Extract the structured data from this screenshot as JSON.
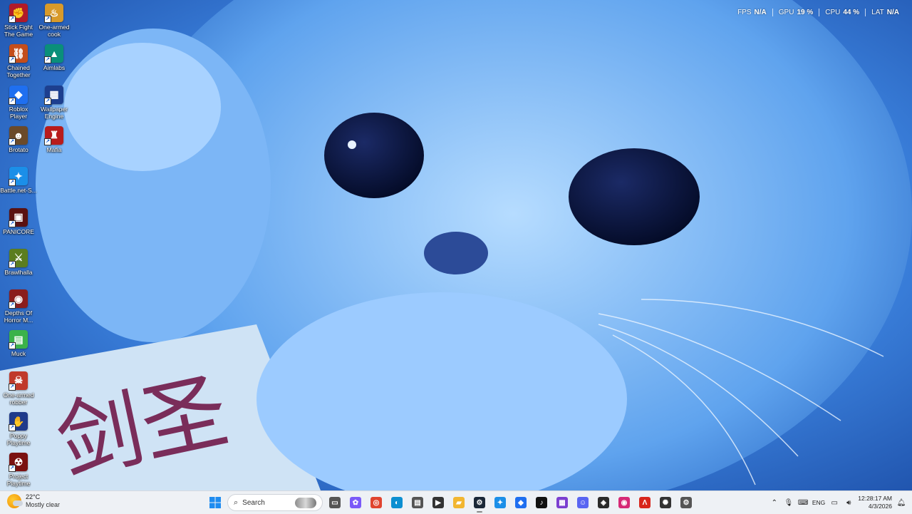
{
  "desktop": {
    "icons_col1": [
      {
        "label": "Stick Fight The Game",
        "glyph": "✊",
        "color": "#b01a2a"
      },
      {
        "label": "Chained Together",
        "glyph": "⛓",
        "color": "#c44d1a"
      },
      {
        "label": "Roblox Player",
        "glyph": "◆",
        "color": "#1f6ff0"
      },
      {
        "label": "Brotato",
        "glyph": "☻",
        "color": "#6b4a2a"
      },
      {
        "label": "Battle.net-S...",
        "glyph": "✦",
        "color": "#1b8fe8"
      },
      {
        "label": "PANICORE",
        "glyph": "▣",
        "color": "#5a1111"
      },
      {
        "label": "Brawlhalla",
        "glyph": "⚔",
        "color": "#5b7d1f"
      },
      {
        "label": "Depths Of Horror M...",
        "glyph": "◉",
        "color": "#8a1d1d"
      },
      {
        "label": "Muck",
        "glyph": "▤",
        "color": "#3bb24a"
      },
      {
        "label": "One-armed robber",
        "glyph": "☠",
        "color": "#c0392b"
      },
      {
        "label": "Poppy Playtime",
        "glyph": "✋",
        "color": "#1f3a8a"
      },
      {
        "label": "Project Playtime",
        "glyph": "☢",
        "color": "#7a1010"
      }
    ],
    "icons_col2": [
      {
        "label": "One-armed cook",
        "glyph": "♨",
        "color": "#d89a2a"
      },
      {
        "label": "Aimlabs",
        "glyph": "▲",
        "color": "#0a8f7a"
      },
      {
        "label": "Wallpaper Engine",
        "glyph": "▦",
        "color": "#1d3f8f"
      },
      {
        "label": "Mafia",
        "glyph": "♜",
        "color": "#b81c1c"
      }
    ]
  },
  "perf_overlay": [
    {
      "key": "FPS",
      "value": "N/A"
    },
    {
      "key": "GPU",
      "value": "19 %"
    },
    {
      "key": "CPU",
      "value": "44 %"
    },
    {
      "key": "LAT",
      "value": "N/A"
    }
  ],
  "taskbar": {
    "weather": {
      "temp": "22°C",
      "condition": "Mostly clear"
    },
    "search_label": "Search",
    "apps": [
      {
        "name": "task-view-icon",
        "glyph": "▭",
        "color": "#555"
      },
      {
        "name": "copilot-icon",
        "glyph": "✿",
        "color": "#7a5af8"
      },
      {
        "name": "chrome-icon",
        "glyph": "◎",
        "color": "#e0442f"
      },
      {
        "name": "edge-icon",
        "glyph": "◐",
        "color": "#0c8fd1"
      },
      {
        "name": "store-icon",
        "glyph": "▤",
        "color": "#555"
      },
      {
        "name": "media-player-icon",
        "glyph": "▶",
        "color": "#333"
      },
      {
        "name": "file-explorer-icon",
        "glyph": "▰",
        "color": "#f2b630"
      },
      {
        "name": "steam-icon",
        "glyph": "⚙",
        "color": "#1b2838"
      },
      {
        "name": "battlenet-icon",
        "glyph": "✦",
        "color": "#1b8fe8"
      },
      {
        "name": "roblox-icon",
        "glyph": "◆",
        "color": "#1f6ff0"
      },
      {
        "name": "tiktok-icon",
        "glyph": "♪",
        "color": "#111"
      },
      {
        "name": "video-app-icon",
        "glyph": "▦",
        "color": "#7b3fd0"
      },
      {
        "name": "discord-icon",
        "glyph": "☺",
        "color": "#5865f2"
      },
      {
        "name": "roblox-studio-icon",
        "glyph": "◈",
        "color": "#2a2a2a"
      },
      {
        "name": "instagram-icon",
        "glyph": "◉",
        "color": "#d62976"
      },
      {
        "name": "adobe-icon",
        "glyph": "Λ",
        "color": "#d8261c"
      },
      {
        "name": "chatgpt-icon",
        "glyph": "✺",
        "color": "#333"
      },
      {
        "name": "settings-icon",
        "glyph": "⚙",
        "color": "#555"
      }
    ],
    "tray": {
      "lang": "ENG",
      "time": "12:28:17 AM",
      "date": "4/3/2026"
    }
  }
}
